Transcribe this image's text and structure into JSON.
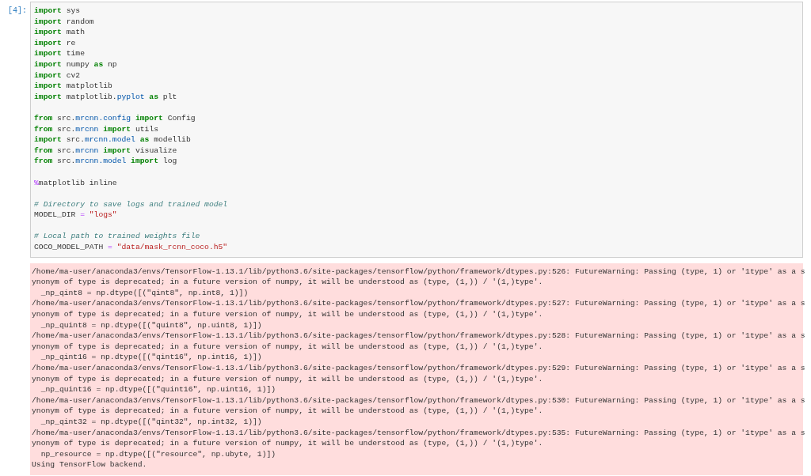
{
  "cell": {
    "prompt": "[4]:",
    "code_blocks": [
      [
        [
          {
            "kind": "kw",
            "text": "import"
          },
          {
            "kind": "plain",
            "text": " sys"
          }
        ],
        [
          {
            "kind": "kw",
            "text": "import"
          },
          {
            "kind": "plain",
            "text": " random"
          }
        ],
        [
          {
            "kind": "kw",
            "text": "import"
          },
          {
            "kind": "plain",
            "text": " math"
          }
        ],
        [
          {
            "kind": "kw",
            "text": "import"
          },
          {
            "kind": "plain",
            "text": " re"
          }
        ],
        [
          {
            "kind": "kw",
            "text": "import"
          },
          {
            "kind": "plain",
            "text": " time"
          }
        ],
        [
          {
            "kind": "kw",
            "text": "import"
          },
          {
            "kind": "plain",
            "text": " numpy "
          },
          {
            "kind": "kw",
            "text": "as"
          },
          {
            "kind": "plain",
            "text": " np"
          }
        ],
        [
          {
            "kind": "kw",
            "text": "import"
          },
          {
            "kind": "plain",
            "text": " cv2"
          }
        ],
        [
          {
            "kind": "kw",
            "text": "import"
          },
          {
            "kind": "plain",
            "text": " matplotlib"
          }
        ],
        [
          {
            "kind": "kw",
            "text": "import"
          },
          {
            "kind": "plain",
            "text": " matplotlib."
          },
          {
            "kind": "attr",
            "text": "pyplot"
          },
          {
            "kind": "kw",
            "text": " as"
          },
          {
            "kind": "plain",
            "text": " plt"
          }
        ]
      ],
      [
        [
          {
            "kind": "kw",
            "text": "from"
          },
          {
            "kind": "plain",
            "text": " src."
          },
          {
            "kind": "attr",
            "text": "mrcnn.config"
          },
          {
            "kind": "kw",
            "text": " import"
          },
          {
            "kind": "plain",
            "text": " Config"
          }
        ],
        [
          {
            "kind": "kw",
            "text": "from"
          },
          {
            "kind": "plain",
            "text": " src."
          },
          {
            "kind": "attr",
            "text": "mrcnn"
          },
          {
            "kind": "kw",
            "text": " import"
          },
          {
            "kind": "plain",
            "text": " utils"
          }
        ],
        [
          {
            "kind": "kw",
            "text": "import"
          },
          {
            "kind": "plain",
            "text": " src."
          },
          {
            "kind": "attr",
            "text": "mrcnn.model"
          },
          {
            "kind": "kw",
            "text": " as"
          },
          {
            "kind": "plain",
            "text": " modellib"
          }
        ],
        [
          {
            "kind": "kw",
            "text": "from"
          },
          {
            "kind": "plain",
            "text": " src."
          },
          {
            "kind": "attr",
            "text": "mrcnn"
          },
          {
            "kind": "kw",
            "text": " import"
          },
          {
            "kind": "plain",
            "text": " visualize"
          }
        ],
        [
          {
            "kind": "kw",
            "text": "from"
          },
          {
            "kind": "plain",
            "text": " src."
          },
          {
            "kind": "attr",
            "text": "mrcnn.model"
          },
          {
            "kind": "kw",
            "text": " import"
          },
          {
            "kind": "plain",
            "text": " log"
          }
        ]
      ],
      [
        [
          {
            "kind": "op",
            "text": "%"
          },
          {
            "kind": "plain",
            "text": "matplotlib inline"
          }
        ]
      ],
      [
        [
          {
            "kind": "comment",
            "text": "# Directory to save logs and trained model"
          }
        ],
        [
          {
            "kind": "plain",
            "text": "MODEL_DIR "
          },
          {
            "kind": "op",
            "text": "="
          },
          {
            "kind": "str",
            "text": " \"logs\""
          }
        ]
      ],
      [
        [
          {
            "kind": "comment",
            "text": "# Local path to trained weights file"
          }
        ],
        [
          {
            "kind": "plain",
            "text": "COCO_MODEL_PATH "
          },
          {
            "kind": "op",
            "text": "="
          },
          {
            "kind": "str",
            "text": " \"data/mask_rcnn_coco.h5\""
          }
        ]
      ]
    ],
    "output_lines": [
      "/home/ma-user/anaconda3/envs/TensorFlow-1.13.1/lib/python3.6/site-packages/tensorflow/python/framework/dtypes.py:526: FutureWarning: Passing (type, 1) or '1type' as a s",
      "ynonym of type is deprecated; in a future version of numpy, it will be understood as (type, (1,)) / '(1,)type'.",
      "  _np_qint8 = np.dtype([(\"qint8\", np.int8, 1)])",
      "/home/ma-user/anaconda3/envs/TensorFlow-1.13.1/lib/python3.6/site-packages/tensorflow/python/framework/dtypes.py:527: FutureWarning: Passing (type, 1) or '1type' as a s",
      "ynonym of type is deprecated; in a future version of numpy, it will be understood as (type, (1,)) / '(1,)type'.",
      "  _np_quint8 = np.dtype([(\"quint8\", np.uint8, 1)])",
      "/home/ma-user/anaconda3/envs/TensorFlow-1.13.1/lib/python3.6/site-packages/tensorflow/python/framework/dtypes.py:528: FutureWarning: Passing (type, 1) or '1type' as a s",
      "ynonym of type is deprecated; in a future version of numpy, it will be understood as (type, (1,)) / '(1,)type'.",
      "  _np_qint16 = np.dtype([(\"qint16\", np.int16, 1)])",
      "/home/ma-user/anaconda3/envs/TensorFlow-1.13.1/lib/python3.6/site-packages/tensorflow/python/framework/dtypes.py:529: FutureWarning: Passing (type, 1) or '1type' as a s",
      "ynonym of type is deprecated; in a future version of numpy, it will be understood as (type, (1,)) / '(1,)type'.",
      "  _np_quint16 = np.dtype([(\"quint16\", np.uint16, 1)])",
      "/home/ma-user/anaconda3/envs/TensorFlow-1.13.1/lib/python3.6/site-packages/tensorflow/python/framework/dtypes.py:530: FutureWarning: Passing (type, 1) or '1type' as a s",
      "ynonym of type is deprecated; in a future version of numpy, it will be understood as (type, (1,)) / '(1,)type'.",
      "  _np_qint32 = np.dtype([(\"qint32\", np.int32, 1)])",
      "/home/ma-user/anaconda3/envs/TensorFlow-1.13.1/lib/python3.6/site-packages/tensorflow/python/framework/dtypes.py:535: FutureWarning: Passing (type, 1) or '1type' as a s",
      "ynonym of type is deprecated; in a future version of numpy, it will be understood as (type, (1,)) / '(1,)type'.",
      "  np_resource = np.dtype([(\"resource\", np.ubyte, 1)])",
      "Using TensorFlow backend."
    ]
  }
}
